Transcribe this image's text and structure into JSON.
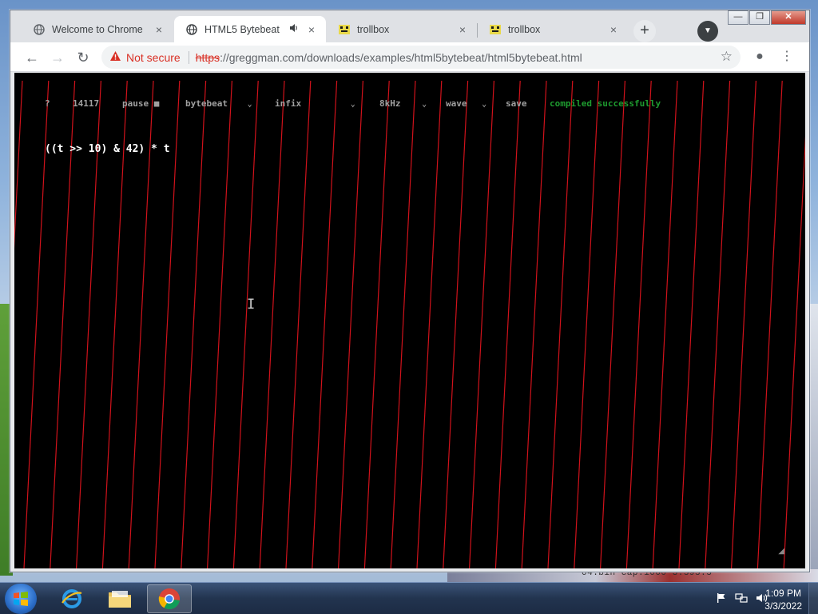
{
  "browser": {
    "tabs": [
      {
        "title": "Welcome to Chrome",
        "icon": "globe-icon",
        "active": false
      },
      {
        "title": "HTML5 Bytebeat",
        "icon": "globe-icon",
        "active": true,
        "audio_icon": "speaker-icon"
      },
      {
        "title": "trollbox",
        "icon": "trollbox-favicon",
        "active": false
      },
      {
        "title": "trollbox",
        "icon": "trollbox-favicon",
        "active": false
      }
    ],
    "close_glyph": "×",
    "new_tab_glyph": "+",
    "profile_glyph": "▼",
    "window": {
      "minimize": "—",
      "maximize": "❐",
      "close": "✕"
    },
    "nav": {
      "back": "←",
      "forward": "→",
      "reload": "↻"
    },
    "omnibox": {
      "warning_label": "Not secure",
      "scheme": "https",
      "url_rest": "://greggman.com/downloads/examples/html5bytebeat/html5bytebeat.html"
    },
    "star_glyph": "☆",
    "account_glyph": "●",
    "menu_glyph": "⋮"
  },
  "bytebeat": {
    "help": "?",
    "time_counter": "14117",
    "pause_label": "pause ■",
    "type_select": "bytebeat",
    "expression_type_select": "infix",
    "sample_rate_select": "8kHz",
    "view_select": "wave",
    "save_label": "save",
    "status": "compiled successfully",
    "expression": "((t >> 10) & 42) * t",
    "chevron": "⌄",
    "colors": {
      "wave": "#e8141e",
      "status": "#1e9b2f",
      "controls": "#a0a0a0"
    }
  },
  "desktop": {
    "background_text": "04.bin   cap.1000     3.595.5",
    "clock_time": "1:09 PM",
    "clock_date": "3/3/2022",
    "tray_icons": [
      "flag-icon",
      "network-icon",
      "volume-icon"
    ]
  },
  "taskbar": {
    "apps": [
      "internet-explorer-icon",
      "file-explorer-icon",
      "chrome-icon"
    ]
  }
}
